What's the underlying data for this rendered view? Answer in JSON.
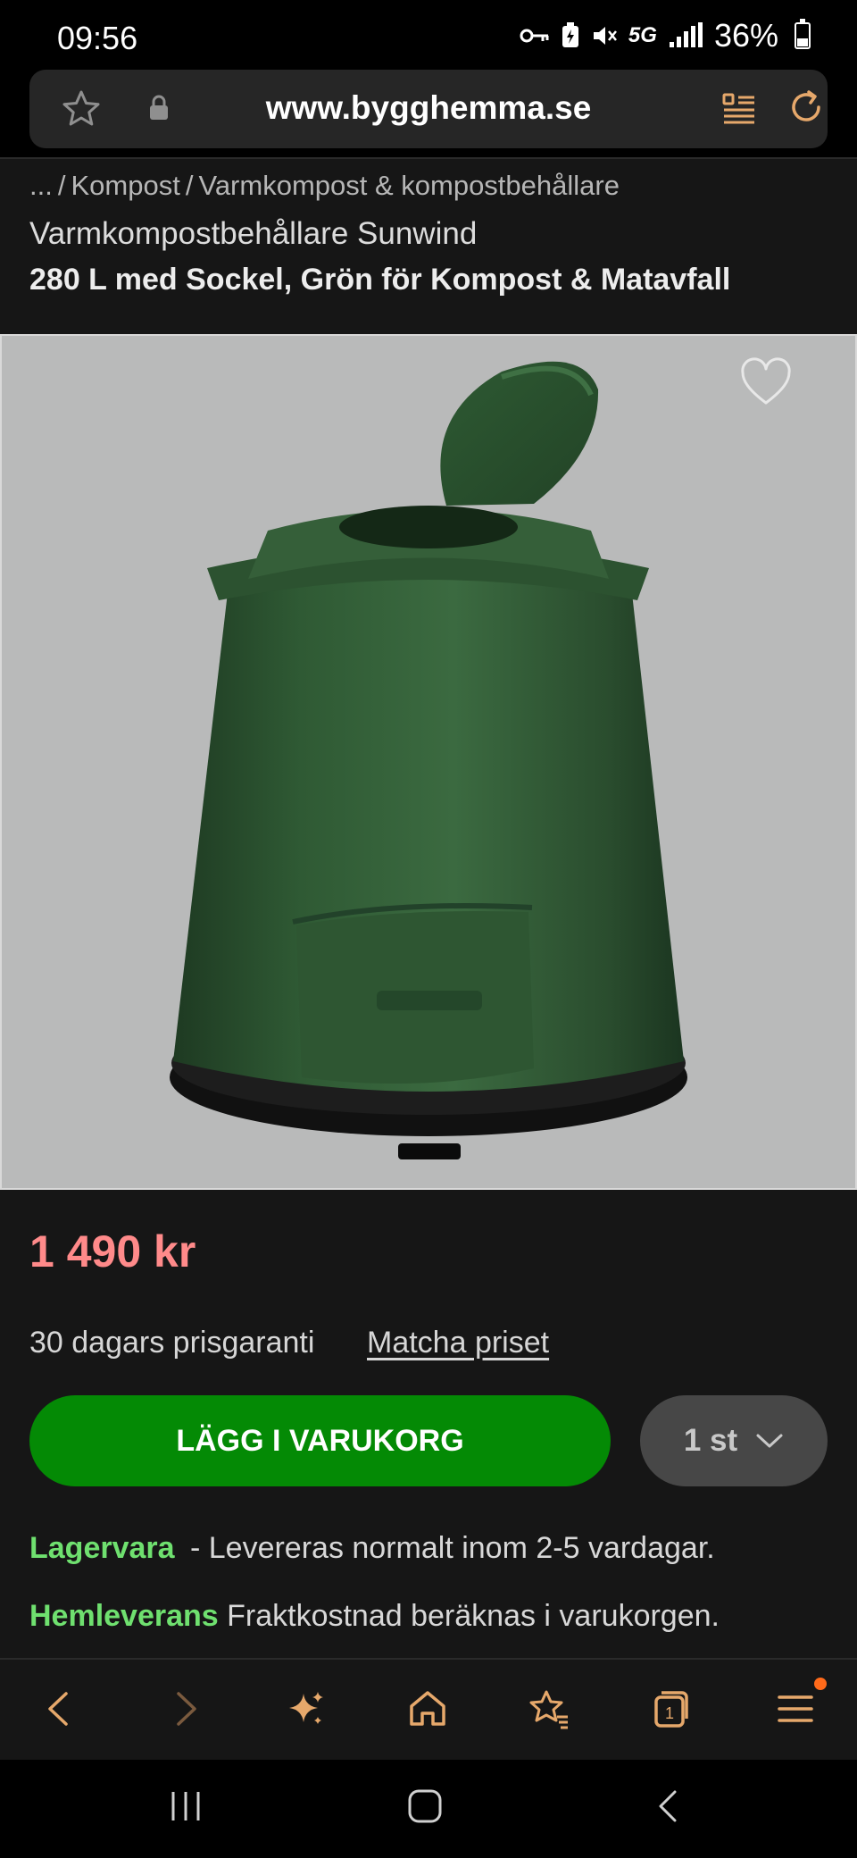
{
  "status_bar": {
    "time": "09:56",
    "network": "5G",
    "battery": "36%"
  },
  "browser": {
    "url": "www.bygghemma.se"
  },
  "breadcrumb": {
    "ellipsis": "...",
    "items": [
      "Kompost",
      "Varmkompost & kompostbehållare"
    ]
  },
  "product": {
    "brand_line": "Varmkompostbehållare Sunwind",
    "title": "280 L med Sockel, Grön för Kompost & Matavfall",
    "price": "1 490 kr",
    "guarantee": "30 dagars prisgaranti",
    "match_price_link": "Matcha priset",
    "add_to_cart": "LÄGG I VARUKORG",
    "quantity": "1 st",
    "stock_label": "Lagervara",
    "stock_text": " - Levereras normalt inom 2-5 vardagar.",
    "delivery_label": "Hemleverans",
    "delivery_text": " Fraktkostnad beräknas i varukorgen."
  },
  "bottom_nav": {
    "tabs_count": "1"
  },
  "colors": {
    "price": "#ff8a8a",
    "cart_button": "#048a05",
    "stock_green": "#6fe06f",
    "page_bg": "#161616",
    "notification_dot": "#ff6a1a"
  },
  "icons": [
    "star-icon",
    "lock-icon",
    "reader-mode-icon",
    "reload-icon",
    "heart-icon",
    "chevron-down-icon",
    "back-icon",
    "forward-icon",
    "sparkle-icon",
    "home-icon",
    "bookmarks-icon",
    "tabs-icon",
    "menu-icon",
    "recent-apps-icon",
    "home-button-icon",
    "system-back-icon"
  ]
}
